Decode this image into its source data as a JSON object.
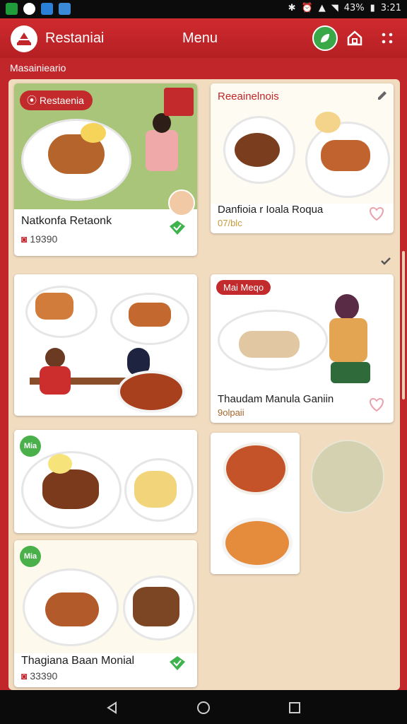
{
  "status_bar": {
    "battery": "43%",
    "time": "3:21"
  },
  "app_bar": {
    "app_name": "Restaniai",
    "title": "Menu"
  },
  "breadcrumb": "Masainieario",
  "cards": [
    {
      "badge": "Restaenia",
      "title": "Natkonfa Retaonk",
      "meta": "19390"
    },
    {
      "badge": "Reeainelnois",
      "title": "Danfioia r Ioala Roqua",
      "meta": "07/blc"
    },
    {
      "badge": "",
      "title": "",
      "meta": ""
    },
    {
      "badge": "Mai Meqo",
      "title": "Thaudam Manula Ganiin",
      "meta": "9olpaii"
    },
    {
      "badge": "Mia",
      "title": "",
      "meta": ""
    },
    {
      "badge": "",
      "title": "",
      "meta": ""
    },
    {
      "badge": "Mia",
      "title": "Thagiana Baan Monial",
      "meta": "33390"
    }
  ],
  "colors": {
    "accent": "#c0262a",
    "panel": "#f1dcc0",
    "green": "#49b04a"
  }
}
